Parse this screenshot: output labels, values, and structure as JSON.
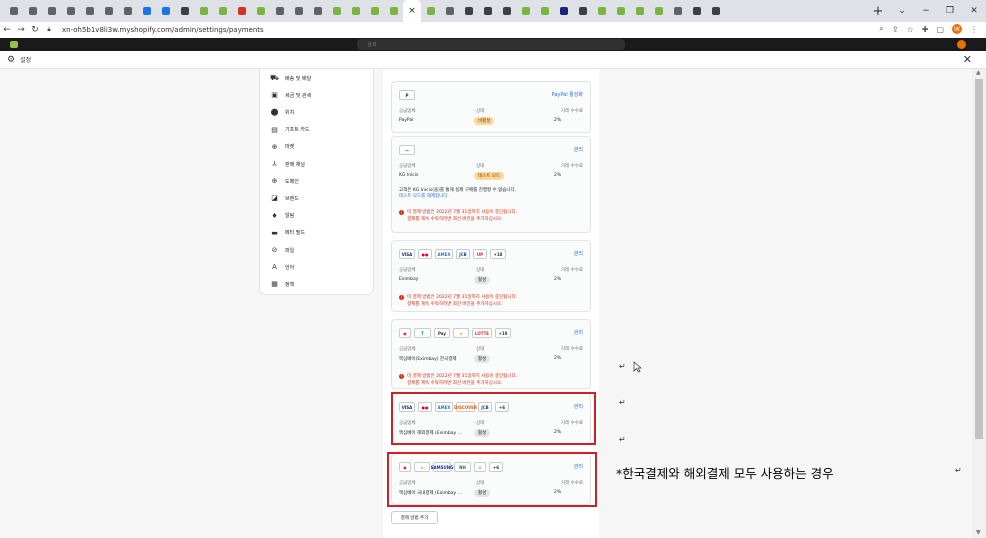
{
  "browser": {
    "tab_colors": [
      "#5f6368",
      "#5f6368",
      "#5f6368",
      "#5f6368",
      "#5f6368",
      "#5f6368",
      "#5f6368",
      "#1a73e8",
      "#1a73e8",
      "#3c4043",
      "#7cb342",
      "#7cb342",
      "#d93025",
      "#7cb342",
      "#5f6368",
      "#5f6368",
      "#5f6368",
      "#7cb342",
      "#7cb342",
      "#7cb342",
      "#7cb342",
      "#7cb342",
      "#5f6368",
      "#3c4043",
      "#3c4043",
      "#3c4043",
      "#7cb342",
      "#7cb342",
      "#1a237e",
      "#3c4043",
      "#7cb342",
      "#7cb342",
      "#7cb342",
      "#7cb342",
      "#5f6368",
      "#3c4043",
      "#3c4043"
    ],
    "active_tab_close": "×",
    "new_tab": "+",
    "url": "xn-oh5b1v8li3w.myshopify.com/admin/settings/payments",
    "profile_initial": "W"
  },
  "admin": {
    "search_placeholder": "검색",
    "settings_title": "설정"
  },
  "sidebar": {
    "items": [
      {
        "icon": "truck-icon",
        "glyph": "⛟",
        "label": "배송 및 배달"
      },
      {
        "icon": "tax-icon",
        "glyph": "▣",
        "label": "세금 및 관세"
      },
      {
        "icon": "location-icon",
        "glyph": "⬤",
        "label": "위치"
      },
      {
        "icon": "gift-card-icon",
        "glyph": "▤",
        "label": "기프트 카드"
      },
      {
        "icon": "markets-icon",
        "glyph": "⊕",
        "label": "마켓"
      },
      {
        "icon": "sales-channels-icon",
        "glyph": "⅄",
        "label": "판매 채널"
      },
      {
        "icon": "domains-icon",
        "glyph": "⊕",
        "label": "도메인"
      },
      {
        "icon": "brand-icon",
        "glyph": "◪",
        "label": "브랜드"
      },
      {
        "icon": "notifications-icon",
        "glyph": "♦",
        "label": "알림"
      },
      {
        "icon": "metafields-icon",
        "glyph": "▬",
        "label": "메타 필드"
      },
      {
        "icon": "files-icon",
        "glyph": "⊘",
        "label": "파일"
      },
      {
        "icon": "languages-icon",
        "glyph": "A",
        "label": "언어"
      },
      {
        "icon": "policies-icon",
        "glyph": "▦",
        "label": "정책"
      }
    ]
  },
  "labels": {
    "provider": "공급업체",
    "status": "상태",
    "fee": "거래 수수료",
    "manage": "관리"
  },
  "payments": [
    {
      "logos": [
        "P"
      ],
      "action": "PayPal 활성화",
      "provider": "PayPal",
      "status": "비활성",
      "fee": "2%"
    },
    {
      "logos": [
        "—"
      ],
      "action": "관리",
      "provider": "KG Inicis",
      "status": "테스트 모드",
      "fee": "2%",
      "note_line1": "고객은 KG Inicis(을)를 통해 실제 구매를 진행할 수 없습니다.",
      "note_link": "테스트 모드를 해제합니다.",
      "warn_line1": "이 결제 방법은 2022년 7월 31일까지 사용이 중단됩니다.",
      "warn_line2": "결제를 계속 수락하려면 최신 버전을 추가하십시오."
    },
    {
      "logos": [
        "VISA",
        "●●",
        "AMEX",
        "JCB",
        "UP",
        "+18"
      ],
      "action": "관리",
      "provider": "Eximbay",
      "status": "활성",
      "fee": "2%",
      "warn_line1": "이 결제 방법은 2022년 7월 31일까지 사용이 중단됩니다.",
      "warn_line2": "결제를 계속 수락하려면 최신 버전을 추가하십시오."
    },
    {
      "logos": [
        "●",
        "T",
        "Pay",
        "★",
        "LOTTE",
        "+10"
      ],
      "action": "관리",
      "provider": "엑심베이(Eximbay) 한국결제",
      "status": "활성",
      "fee": "2%",
      "warn_line1": "이 결제 방법은 2022년 7월 31일까지 사용이 중단됩니다.",
      "warn_line2": "결제를 계속 수락하려면 최신 버전을 추가하십시오."
    },
    {
      "logos": [
        "VISA",
        "●●",
        "AMEX",
        "DISCOVER",
        "JCB",
        "+6"
      ],
      "action": "관리",
      "provider": "엑심베이 해외결제 (Eximbay ...",
      "status": "활성",
      "fee": "2%"
    },
    {
      "logos": [
        "●",
        "★",
        "SAMSUNG",
        "NH",
        "◎",
        "+6"
      ],
      "action": "관리",
      "provider": "엑심베이 국내결제 (Eximbay ...",
      "status": "활성",
      "fee": "2%"
    }
  ],
  "add_payment": "결제 방법 추가",
  "caption": "*한국결제와 해외결제 모두 사용하는 경우",
  "return_mark": "↵"
}
